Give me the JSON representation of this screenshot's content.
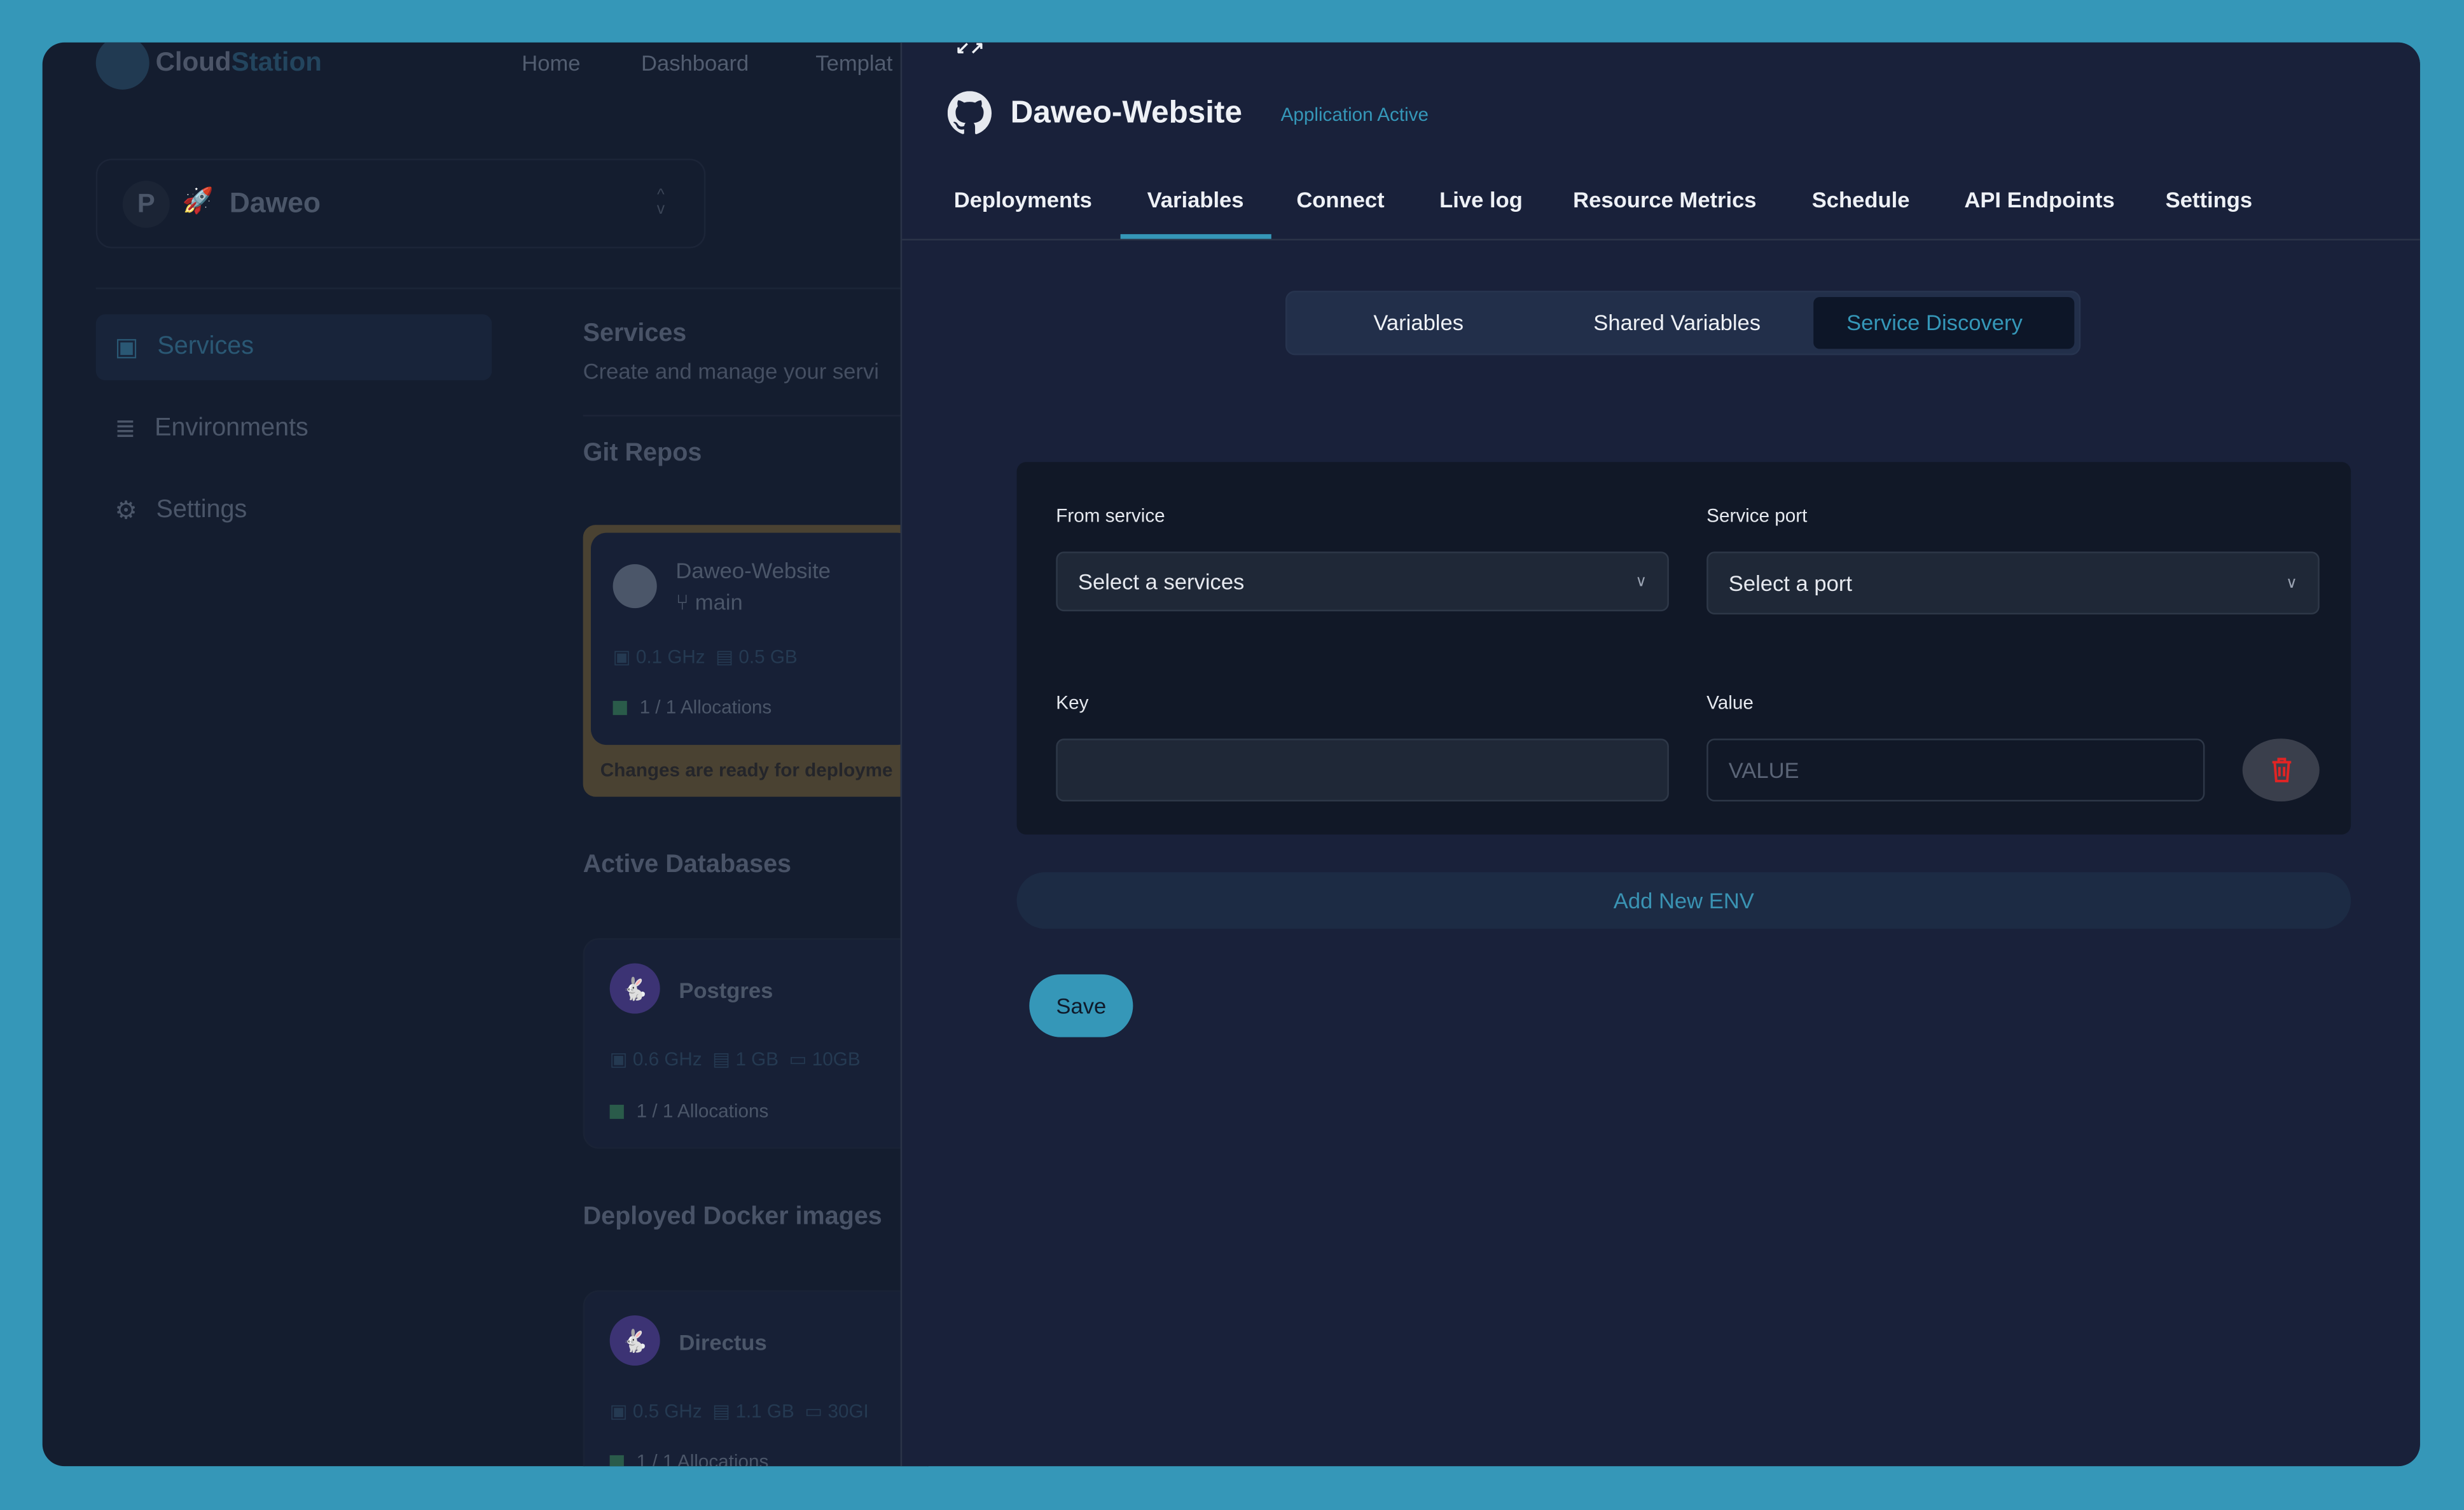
{
  "colors": {
    "background": "#3597b8",
    "accent": "#3597b8",
    "panel": "#19213a",
    "danger": "#e02424"
  },
  "header": {
    "logo_part1": "Cloud",
    "logo_part2": "Station",
    "nav": [
      "Home",
      "Dashboard",
      "Templat"
    ]
  },
  "project": {
    "initial": "P",
    "name": "Daweo"
  },
  "sidebar": {
    "items": [
      {
        "label": "Services",
        "icon": "services-icon",
        "active": true
      },
      {
        "label": "Environments",
        "icon": "database-icon"
      },
      {
        "label": "Settings",
        "icon": "sliders-icon"
      }
    ]
  },
  "main": {
    "title": "Services",
    "subtitle": "Create and manage your servi",
    "git_repos_heading": "Git Repos",
    "repo": {
      "name": "Daweo-Website",
      "branch": "main",
      "cpu": "0.1 GHz",
      "ram": "0.5 GB",
      "alloc": "1 / 1 Allocations",
      "notice": "Changes are ready for deployme"
    },
    "databases_heading": "Active Databases",
    "db": {
      "name": "Postgres",
      "cpu": "0.6 GHz",
      "ram": "1 GB",
      "disk": "10GB",
      "alloc": "1 / 1 Allocations"
    },
    "docker_heading": "Deployed Docker images",
    "docker": {
      "name": "Directus",
      "cpu": "0.5 GHz",
      "ram": "1.1 GB",
      "disk": "30GI",
      "alloc": "1 / 1 Allocations"
    }
  },
  "panel": {
    "title": "Daweo-Website",
    "status": "Application Active",
    "tabs": [
      "Deployments",
      "Variables",
      "Connect",
      "Live log",
      "Resource Metrics",
      "Schedule",
      "API Endpoints",
      "Settings"
    ],
    "active_tab": "Variables",
    "subtabs": [
      "Variables",
      "Shared Variables",
      "Service Discovery"
    ],
    "active_subtab": "Service Discovery",
    "form": {
      "from_service_label": "From service",
      "from_service_value": "Select a services",
      "service_port_label": "Service port",
      "service_port_value": "Select a port",
      "key_label": "Key",
      "key_value": "",
      "value_label": "Value",
      "value_placeholder": "VALUE"
    },
    "add_env_label": "Add New ENV",
    "save_label": "Save"
  }
}
